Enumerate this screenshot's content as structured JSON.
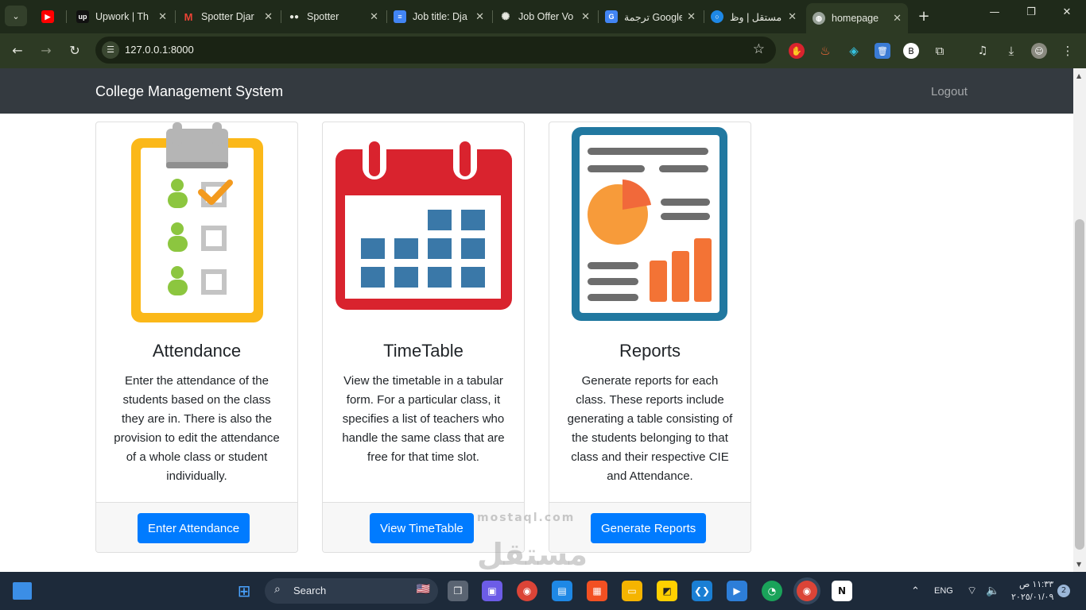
{
  "browser": {
    "tabs": [
      {
        "title": "",
        "icon": "youtube-icon",
        "color": "#ff0000"
      },
      {
        "title": "Upwork | Th",
        "icon": "upwork-icon",
        "color": "#111111"
      },
      {
        "title": "Spotter Djar",
        "icon": "gmail-icon",
        "color": "#ea4335"
      },
      {
        "title": "Spotter",
        "icon": "spotter-icon",
        "color": "#2d2d2d"
      },
      {
        "title": "Job title: Dja",
        "icon": "docs-icon",
        "color": "#4285f4"
      },
      {
        "title": "Job Offer Vo",
        "icon": "openai-icon",
        "color": "#333333"
      },
      {
        "title": "ترجمة Google",
        "icon": "translate-icon",
        "color": "#4285f4"
      },
      {
        "title": "مستقل | وظ",
        "icon": "mostaql-icon",
        "color": "#1e88e5"
      },
      {
        "title": "homepage",
        "icon": "globe-icon",
        "color": "#9aa39a"
      }
    ],
    "new_tab": "+",
    "url": "127.0.0.1:8000"
  },
  "navbar": {
    "brand": "College Management System",
    "logout": "Logout"
  },
  "cards": [
    {
      "title": "Attendance",
      "text": "Enter the attendance of the students based on the class they are in. There is also the provision to edit the attendance of a whole class or student individually.",
      "button": "Enter Attendance"
    },
    {
      "title": "TimeTable",
      "text": "View the timetable in a tabular form. For a particular class, it specifies a list of teachers who handle the same class that are free for that time slot.",
      "button": "View TimeTable"
    },
    {
      "title": "Reports",
      "text": "Generate reports for each class. These reports include generating a table consisting of the students belonging to that class and their respective CIE and Attendance.",
      "button": "Generate Reports"
    }
  ],
  "watermark": {
    "text": "مستقل",
    "sub": "mostaql.com"
  },
  "taskbar": {
    "search": "Search",
    "language": "ENG",
    "time": "١١:٣٣ ص",
    "date": "٢٠٢٥/٠١/٠٩",
    "notifications": "2"
  },
  "colors": {
    "navbar": "#343a40",
    "primary": "#007bff",
    "attendance_frame": "#fbb819",
    "calendar_red": "#d9232e",
    "calendar_blue": "#3a78a8",
    "report_frame": "#2178a0",
    "report_orange": "#f37335"
  }
}
